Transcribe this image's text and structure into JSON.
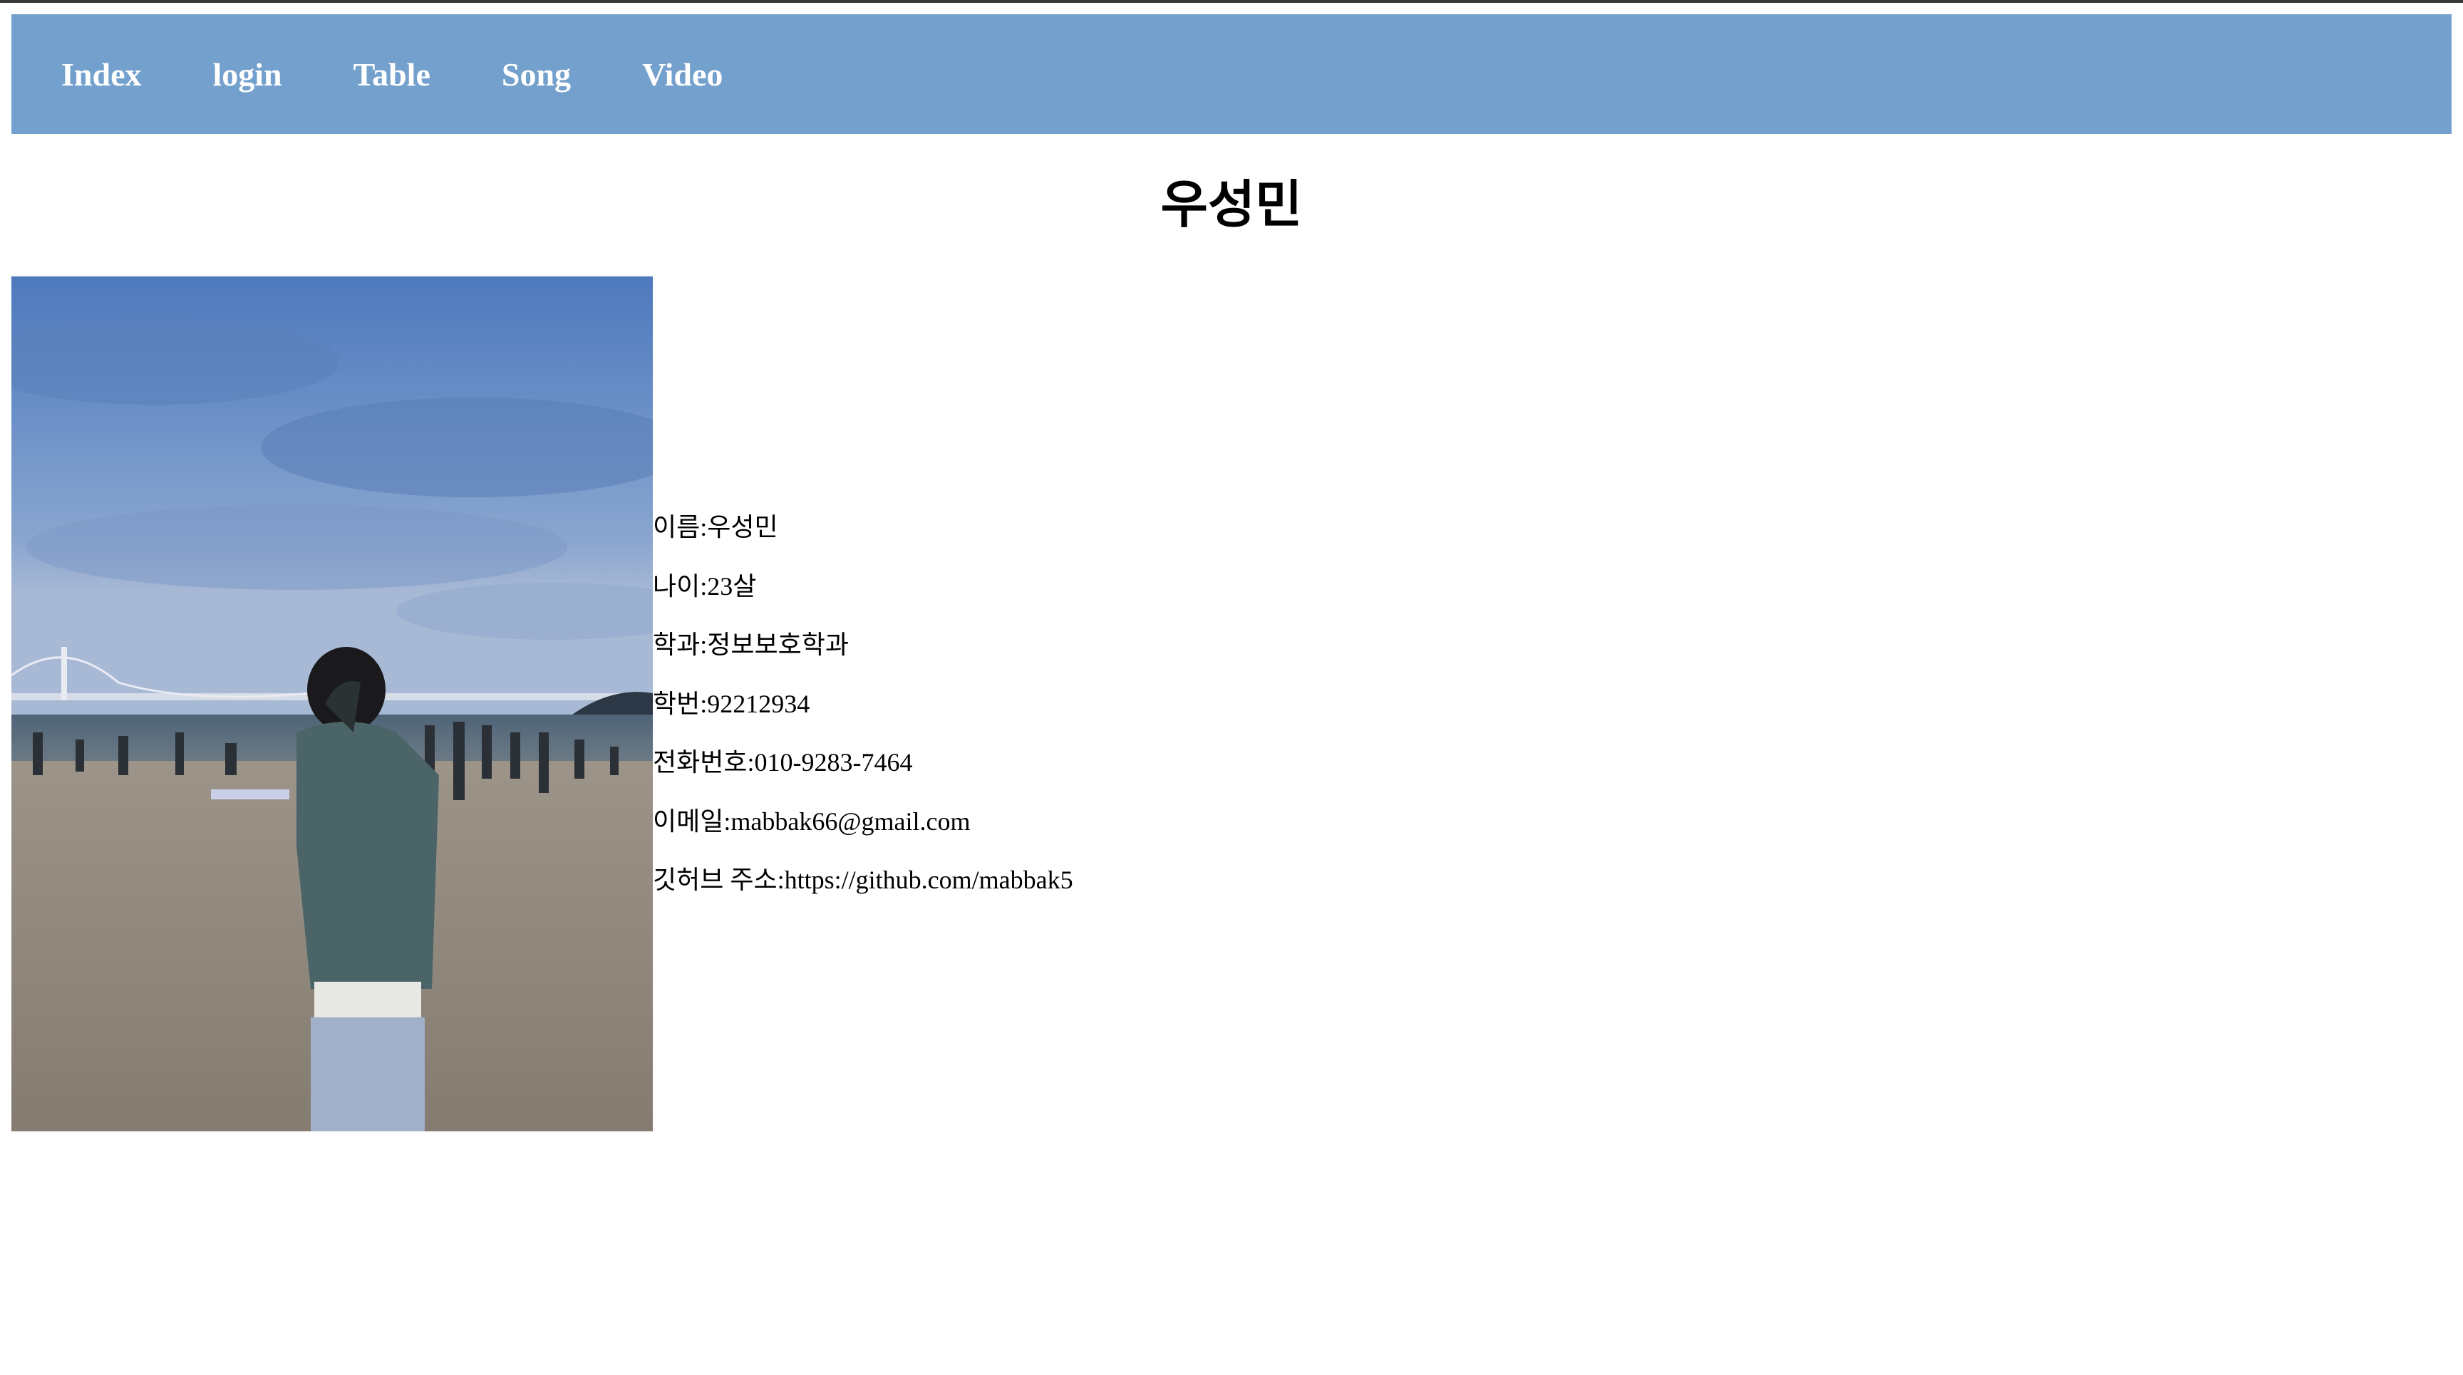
{
  "nav": {
    "items": [
      {
        "label": "Index"
      },
      {
        "label": "login"
      },
      {
        "label": "Table"
      },
      {
        "label": "Song"
      },
      {
        "label": "Video"
      }
    ],
    "background": "#73a0cc"
  },
  "page": {
    "title": "우성민"
  },
  "profile": {
    "fields": [
      {
        "label": "이름:",
        "value": "우성민"
      },
      {
        "label": "나이:",
        "value": "23살"
      },
      {
        "label": "학과:",
        "value": "정보보호학과"
      },
      {
        "label": "학번:",
        "value": "92212934"
      },
      {
        "label": "전화번호:",
        "value": "010-9283-7464"
      },
      {
        "label": "이메일:",
        "value": "mabbak66@gmail.com"
      },
      {
        "label": "깃허브 주소:",
        "value": "https://github.com/mabbak5"
      }
    ]
  }
}
